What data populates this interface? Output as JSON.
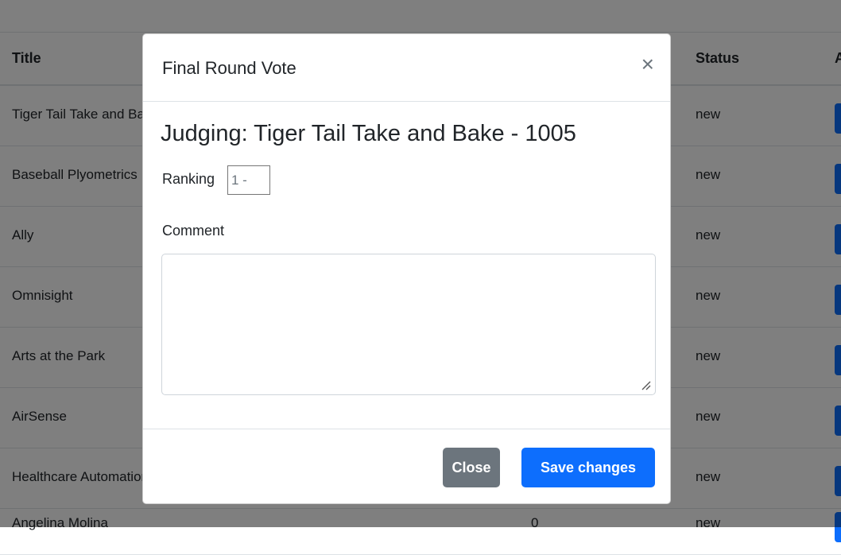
{
  "table": {
    "headers": {
      "title": "Title",
      "status": "Status",
      "actions": "A"
    },
    "rows": [
      {
        "title": "Tiger Tail Take and Bake",
        "number": "",
        "status": "new"
      },
      {
        "title": "Baseball Plyometrics",
        "number": "",
        "status": "new"
      },
      {
        "title": "Ally",
        "number": "",
        "status": "new"
      },
      {
        "title": "Omnisight",
        "number": "",
        "status": "new"
      },
      {
        "title": "Arts at the Park",
        "number": "",
        "status": "new"
      },
      {
        "title": "AirSense",
        "number": "",
        "status": "new"
      },
      {
        "title": "Healthcare Automation",
        "number": "",
        "status": "new"
      },
      {
        "title": "Angelina Molina",
        "number": "0",
        "status": "new"
      }
    ]
  },
  "modal": {
    "title": "Final Round Vote",
    "close_icon": "×",
    "judging": "Judging: Tiger Tail Take and Bake - 1005",
    "ranking_label": "Ranking",
    "ranking_value": "1 -",
    "comment_label": "Comment",
    "comment_value": "",
    "close_button": "Close",
    "save_button": "Save changes"
  },
  "colors": {
    "primary": "#0d6efd",
    "secondary": "#6c757d",
    "backdrop": "rgba(0,0,0,0.5)"
  }
}
